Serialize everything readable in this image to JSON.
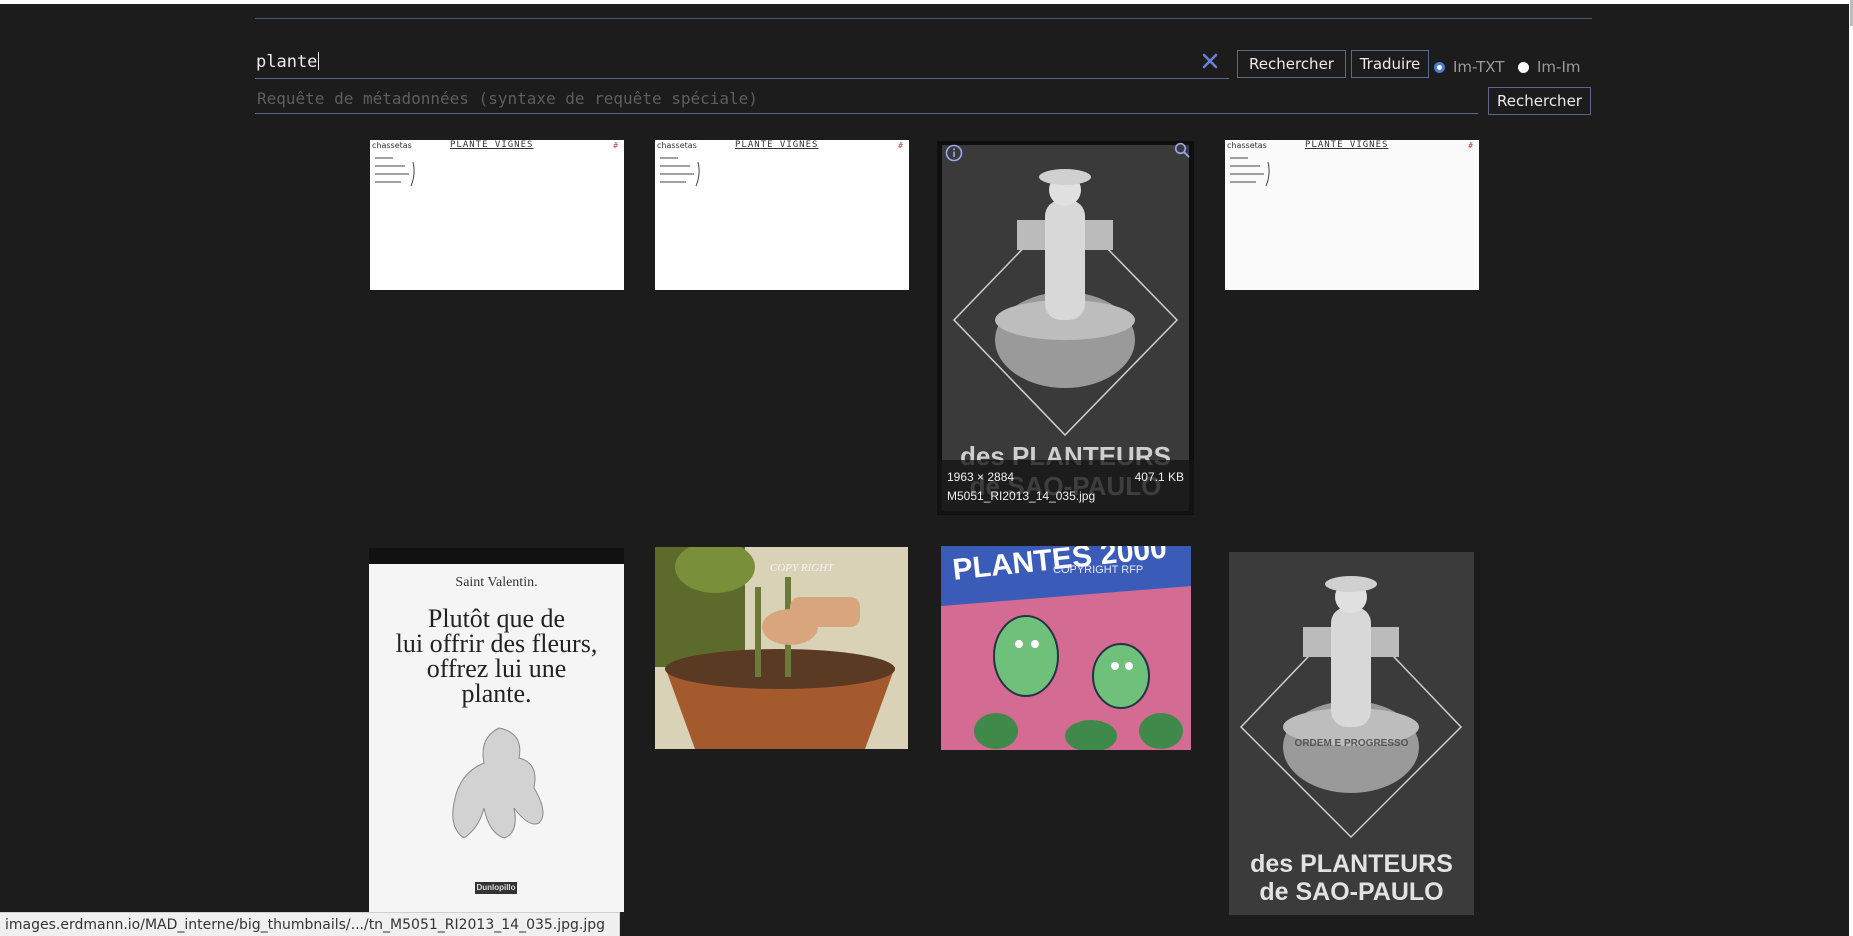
{
  "search": {
    "query": "plante",
    "search_label": "Rechercher",
    "translate_label": "Traduire",
    "mode_options": [
      "Im-TXT",
      "Im-Im"
    ],
    "mode_selected": "Im-TXT"
  },
  "metadata": {
    "placeholder": "Requête de métadonnées (syntaxe de requête spéciale)",
    "search_label": "Rechercher"
  },
  "results": {
    "doc_header_left": "chassetas",
    "doc_header_title": "PLANTE VIGNES",
    "doc_hash": "#",
    "planteurs_line1": "des PLANTEURS",
    "planteurs_line2": "de SAO-PAULO",
    "planteurs_band": "ORDEM E PROGRESSO",
    "hover": {
      "dimensions": "1963 × 2884",
      "size": "407.1 KB",
      "filename": "M5051_RI2013_14_035.jpg"
    },
    "valentin": {
      "small": "Saint Valentin.",
      "big_lines": [
        "Plutôt que de",
        "lui offrir des fleurs,",
        "offrez lui une",
        "plante."
      ],
      "brand": "Dunlopillo"
    },
    "copyright_text": "COPY RIGHT",
    "plantes_title": "PLANTES 2000",
    "plantes_sub": "COPYRIGHT RFP"
  },
  "status_bar": {
    "url": "images.erdmann.io/MAD_interne/big_thumbnails/.../tn_M5051_RI2013_14_035.jpg.jpg"
  },
  "colors": {
    "background": "#1c1c1c",
    "accent": "#4a7bd8",
    "border": "#5a6a8a",
    "clear_icon": "#6b7fd6"
  }
}
